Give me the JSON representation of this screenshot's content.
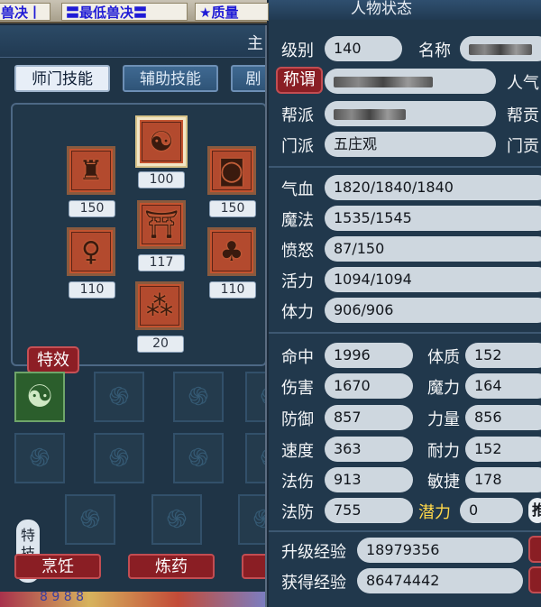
{
  "banner": {
    "items": [
      "兽决丨",
      "〓最低兽决〓",
      "★质量"
    ]
  },
  "skill_panel": {
    "title": "主",
    "tabs": [
      "师门技能",
      "辅助技能",
      "剧"
    ],
    "skills": [
      {
        "name": "top",
        "level": "100"
      },
      {
        "name": "left-1",
        "level": "150"
      },
      {
        "name": "right-1",
        "level": "150"
      },
      {
        "name": "center",
        "level": "117"
      },
      {
        "name": "left-2",
        "level": "110"
      },
      {
        "name": "right-2",
        "level": "110"
      },
      {
        "name": "bottom",
        "level": "20"
      }
    ],
    "special_label": "特效",
    "special_skill_label": "特技",
    "cook_label": "烹饪",
    "medicine_label": "炼药",
    "bottom_text": "8   9 8 8"
  },
  "status": {
    "title": "人物状态",
    "level_label": "级别",
    "level_value": "140",
    "name_label": "名称",
    "title_button": "称谓",
    "popularity_label": "人气",
    "gang_label": "帮派",
    "gang_contrib_label": "帮贡",
    "school_label": "门派",
    "school_value": "五庄观",
    "school_contrib_label": "门贡",
    "hp_label": "气血",
    "hp_value": "1820/1840/1840",
    "mp_label": "魔法",
    "mp_value": "1535/1545",
    "anger_label": "愤怒",
    "anger_value": "87/150",
    "vitality_label": "活力",
    "vitality_value": "1094/1094",
    "stamina_label": "体力",
    "stamina_value": "906/906",
    "hit_label": "命中",
    "hit_value": "1996",
    "con_label": "体质",
    "con_value": "152",
    "damage_label": "伤害",
    "damage_value": "1670",
    "magic_label": "魔力",
    "magic_value": "164",
    "defense_label": "防御",
    "defense_value": "857",
    "str_label": "力量",
    "str_value": "856",
    "speed_label": "速度",
    "speed_value": "363",
    "end_label": "耐力",
    "end_value": "152",
    "mdmg_label": "法伤",
    "mdmg_value": "913",
    "agi_label": "敏捷",
    "agi_value": "178",
    "mdef_label": "法防",
    "mdef_value": "755",
    "potential_label": "潜力",
    "potential_value": "0",
    "assign_button": "推",
    "upgrade_exp_label": "升级经验",
    "upgrade_exp_value": "18979356",
    "gained_exp_label": "获得经验",
    "gained_exp_value": "86474442"
  }
}
